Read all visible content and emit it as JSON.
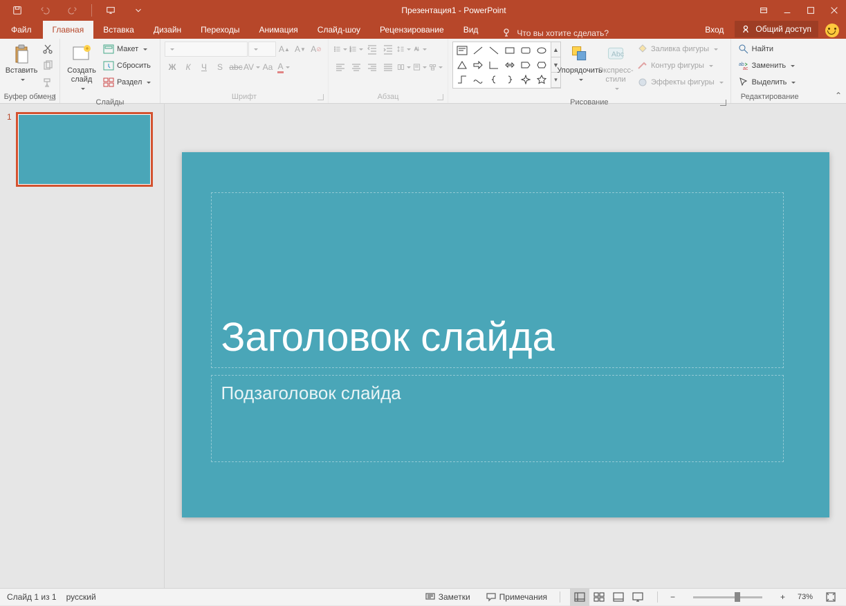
{
  "title": "Презентация1 - PowerPoint",
  "tabs": {
    "file": "Файл",
    "home": "Главная",
    "insert": "Вставка",
    "design": "Дизайн",
    "transitions": "Переходы",
    "animations": "Анимация",
    "slideshow": "Слайд-шоу",
    "review": "Рецензирование",
    "view": "Вид"
  },
  "tell_me": "Что вы хотите сделать?",
  "signin": "Вход",
  "share": "Общий доступ",
  "ribbon": {
    "clipboard": {
      "label": "Буфер обмена",
      "paste": "Вставить"
    },
    "slides": {
      "label": "Слайды",
      "new_slide": "Создать\nслайд",
      "layout": "Макет",
      "reset": "Сбросить",
      "section": "Раздел"
    },
    "font": {
      "label": "Шрифт"
    },
    "paragraph": {
      "label": "Абзац"
    },
    "drawing": {
      "label": "Рисование",
      "arrange": "Упорядочить",
      "quick_styles": "Экспресс-\nстили",
      "fill": "Заливка фигуры",
      "outline": "Контур фигуры",
      "effects": "Эффекты фигуры"
    },
    "editing": {
      "label": "Редактирование",
      "find": "Найти",
      "replace": "Заменить",
      "select": "Выделить"
    }
  },
  "slide": {
    "number": "1",
    "title_ph": "Заголовок слайда",
    "subtitle_ph": "Подзаголовок слайда"
  },
  "status": {
    "slide_of": "Слайд 1 из 1",
    "lang": "русский",
    "notes": "Заметки",
    "comments": "Примечания",
    "zoom": "73%"
  }
}
